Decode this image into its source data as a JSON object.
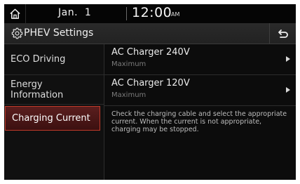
{
  "status_bar": {
    "home_icon": "home-icon",
    "date": "Jan.  1",
    "time": "12:00",
    "ampm": "AM"
  },
  "header": {
    "icon": "gear-icon",
    "title": "PHEV Settings",
    "back_icon": "back-arrow-icon"
  },
  "sidebar": {
    "items": [
      {
        "label": "ECO Driving",
        "selected": false
      },
      {
        "label": "Energy\nInformation",
        "selected": false
      },
      {
        "label": "Charging Current",
        "selected": true
      }
    ]
  },
  "main": {
    "options": [
      {
        "title": "AC Charger 240V",
        "value": "Maximum"
      },
      {
        "title": "AC Charger 120V",
        "value": "Maximum"
      }
    ],
    "info": "Check the charging cable and select the appropriate current. When the current is not appropriate, charging may be stopped."
  },
  "colors": {
    "selected_border": "#c03a2a",
    "selected_fill": "#5a1e1e",
    "background": "#0c0c0c"
  }
}
